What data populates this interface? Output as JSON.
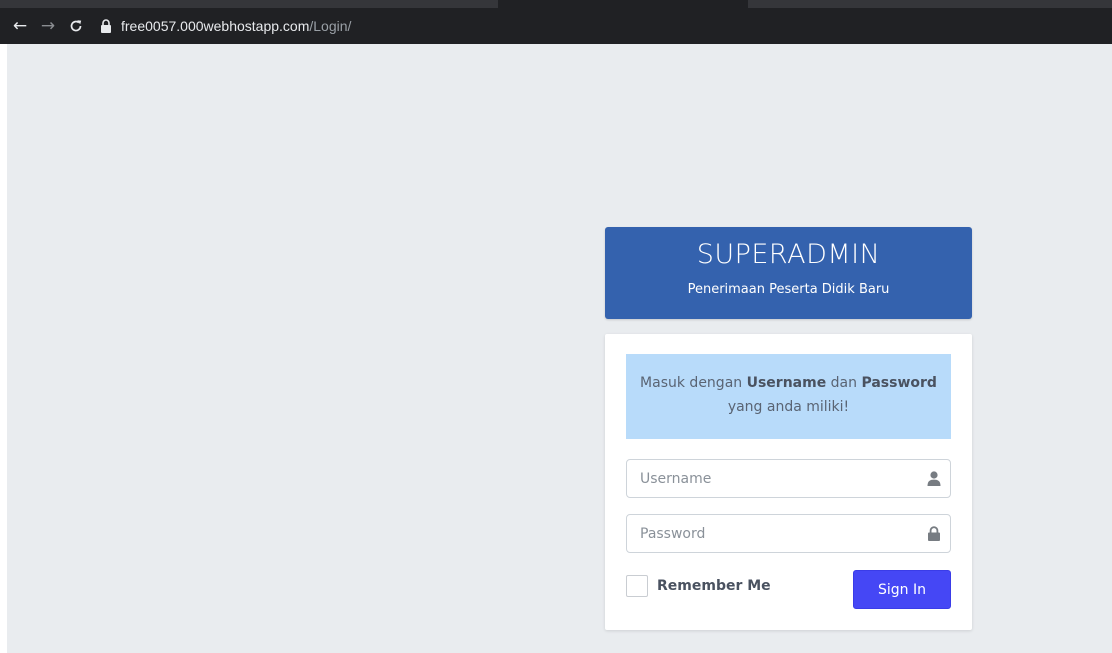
{
  "browser": {
    "url_domain": "free0057.000webhostapp.com",
    "url_path": "/Login/",
    "back_icon": "arrow-left-icon",
    "forward_icon": "arrow-right-icon",
    "reload_icon": "reload-icon",
    "lock_icon": "lock-icon"
  },
  "header": {
    "title": "SUPERADMIN",
    "subtitle": "Penerimaan Peserta Didik Baru",
    "color": "#3462ae"
  },
  "info": {
    "prefix": "Masuk dengan ",
    "username_word": "Username",
    "middle": " dan ",
    "password_word": "Password",
    "suffix": "yang anda miliki!",
    "color": "#b8dbfa"
  },
  "form": {
    "username_placeholder": "Username",
    "username_value": "",
    "password_placeholder": "Password",
    "password_value": "",
    "remember_label": "Remember Me",
    "remember_checked": false,
    "signin_label": "Sign In",
    "signin_color": "#4547f5"
  }
}
